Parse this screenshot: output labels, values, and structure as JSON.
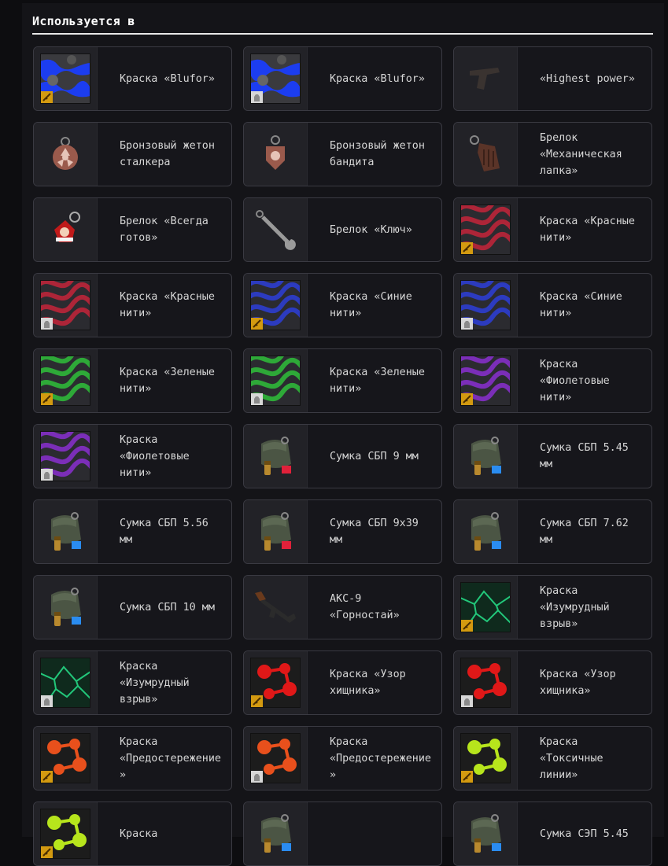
{
  "section": {
    "title": "Используется в"
  },
  "items": [
    {
      "label": "Краска «Blufor»",
      "icon": "paint-swatch-icon",
      "kind": "paint",
      "pattern": "camo",
      "color": "#1c3df0",
      "badge": "weapon"
    },
    {
      "label": "Краска «Blufor»",
      "icon": "paint-swatch-icon",
      "kind": "paint",
      "pattern": "camo",
      "color": "#1c3df0",
      "badge": "armor"
    },
    {
      "label": "«Highest power»",
      "icon": "pistol-icon",
      "kind": "pistol"
    },
    {
      "label": "Бронзовый жетон сталкера",
      "icon": "bronze-token-icon",
      "kind": "token",
      "shape": "round"
    },
    {
      "label": "Бронзовый жетон бандита",
      "icon": "bronze-token-icon",
      "kind": "token",
      "shape": "shield"
    },
    {
      "label": "Брелок «Механическая лапка»",
      "icon": "keychain-icon",
      "kind": "paw"
    },
    {
      "label": "Брелок «Всегда готов»",
      "icon": "badge-keychain-icon",
      "kind": "pin"
    },
    {
      "label": "Брелок «Ключ»",
      "icon": "wrench-icon",
      "kind": "wrench"
    },
    {
      "label": "Краска «Красные нити»",
      "icon": "paint-swatch-icon",
      "kind": "paint",
      "pattern": "threads",
      "color": "#c4243a",
      "badge": "weapon"
    },
    {
      "label": "Краска «Красные нити»",
      "icon": "paint-swatch-icon",
      "kind": "paint",
      "pattern": "threads",
      "color": "#c4243a",
      "badge": "armor"
    },
    {
      "label": "Краска «Синие нити»",
      "icon": "paint-swatch-icon",
      "kind": "paint",
      "pattern": "threads",
      "color": "#2d3ed8",
      "badge": "weapon"
    },
    {
      "label": "Краска «Синие нити»",
      "icon": "paint-swatch-icon",
      "kind": "paint",
      "pattern": "threads",
      "color": "#2d3ed8",
      "badge": "armor"
    },
    {
      "label": "Краска «Зеленые нити»",
      "icon": "paint-swatch-icon",
      "kind": "paint",
      "pattern": "threads",
      "color": "#2fbf3a",
      "badge": "weapon"
    },
    {
      "label": "Краска «Зеленые нити»",
      "icon": "paint-swatch-icon",
      "kind": "paint",
      "pattern": "threads",
      "color": "#2fbf3a",
      "badge": "armor"
    },
    {
      "label": "Краска «Фиолетовые нити»",
      "icon": "paint-swatch-icon",
      "kind": "paint",
      "pattern": "threads",
      "color": "#8a2fd0",
      "badge": "weapon"
    },
    {
      "label": "Краска «Фиолетовые нити»",
      "icon": "paint-swatch-icon",
      "kind": "paint",
      "pattern": "threads",
      "color": "#8a2fd0",
      "badge": "armor"
    },
    {
      "label": "Сумка СБП 9 мм",
      "icon": "ammo-bag-icon",
      "kind": "bag",
      "tag": "#e0213a"
    },
    {
      "label": "Сумка СБП 5.45 мм",
      "icon": "ammo-bag-icon",
      "kind": "bag",
      "tag": "#2a8cf0"
    },
    {
      "label": "Сумка СБП 5.56 мм",
      "icon": "ammo-bag-icon",
      "kind": "bag",
      "tag": "#2a8cf0"
    },
    {
      "label": "Сумка СБП 9х39 мм",
      "icon": "ammo-bag-icon",
      "kind": "bag",
      "tag": "#e0213a"
    },
    {
      "label": "Сумка СБП 7.62 мм",
      "icon": "ammo-bag-icon",
      "kind": "bag",
      "tag": "#2a8cf0"
    },
    {
      "label": "Сумка СБП 10 мм",
      "icon": "ammo-bag-icon",
      "kind": "bag",
      "tag": "#2a8cf0"
    },
    {
      "label": "АКС-9 «Горностай»",
      "icon": "rifle-icon",
      "kind": "rifle"
    },
    {
      "label": "Краска «Изумрудный взрыв»",
      "icon": "paint-swatch-icon",
      "kind": "paint",
      "pattern": "veins",
      "color": "#22c77a",
      "badge": "weapon"
    },
    {
      "label": "Краска «Изумрудный взрыв»",
      "icon": "paint-swatch-icon",
      "kind": "paint",
      "pattern": "veins",
      "color": "#22c77a",
      "badge": "armor"
    },
    {
      "label": "Краска «Узор хищника»",
      "icon": "paint-swatch-icon",
      "kind": "paint",
      "pattern": "dots",
      "color": "#e01818",
      "badge": "weapon"
    },
    {
      "label": "Краска «Узор хищника»",
      "icon": "paint-swatch-icon",
      "kind": "paint",
      "pattern": "dots",
      "color": "#e01818",
      "badge": "armor"
    },
    {
      "label": "Краска «Предостережение»",
      "icon": "paint-swatch-icon",
      "kind": "paint",
      "pattern": "dots",
      "color": "#e8501c",
      "badge": "weapon"
    },
    {
      "label": "Краска «Предостережение»",
      "icon": "paint-swatch-icon",
      "kind": "paint",
      "pattern": "dots",
      "color": "#e8501c",
      "badge": "armor"
    },
    {
      "label": "Краска «Токсичные линии»",
      "icon": "paint-swatch-icon",
      "kind": "paint",
      "pattern": "dots",
      "color": "#b7e51c",
      "badge": "weapon"
    },
    {
      "label": "Краска",
      "icon": "paint-swatch-icon",
      "kind": "paint",
      "pattern": "dots",
      "color": "#b7e51c",
      "badge": "weapon"
    },
    {
      "label": "",
      "icon": "ammo-bag-icon",
      "kind": "bag",
      "tag": "#2a8cf0"
    },
    {
      "label": "Сумка СЭП 5.45",
      "icon": "ammo-bag-icon",
      "kind": "bag",
      "tag": "#2a8cf0"
    }
  ]
}
